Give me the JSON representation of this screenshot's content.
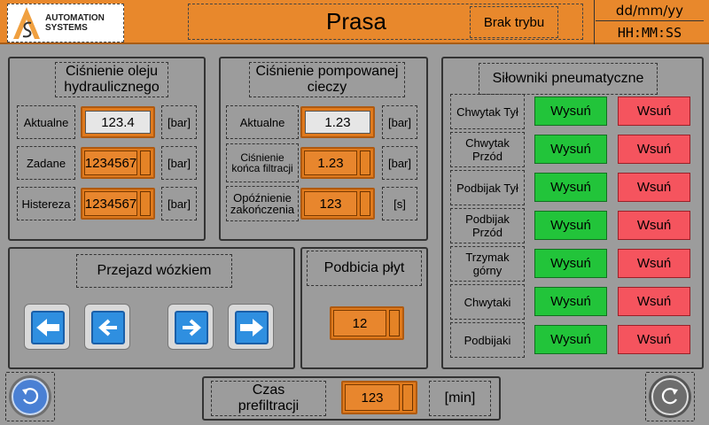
{
  "header": {
    "logo_line1": "AUTOMATION",
    "logo_line2": "SYSTEMS",
    "title": "Prasa",
    "mode": "Brak trybu",
    "date": "dd/mm/yy",
    "time": "HH:MM:SS"
  },
  "oil": {
    "title": "Ciśnienie oleju hydraulicznego",
    "rows": [
      {
        "label": "Aktualne",
        "value": "123.4",
        "unit": "[bar]"
      },
      {
        "label": "Zadane",
        "value": "1234567",
        "unit": "[bar]"
      },
      {
        "label": "Histereza",
        "value": "1234567",
        "unit": "[bar]"
      }
    ]
  },
  "liquid": {
    "title": "Ciśnienie pompowanej cieczy",
    "rows": [
      {
        "label": "Aktualne",
        "value": "1.23",
        "unit": "[bar]"
      },
      {
        "label": "Ciśnienie końca filtracji",
        "value": "1.23",
        "unit": "[bar]"
      },
      {
        "label": "Opóźnienie zakończenia",
        "value": "123",
        "unit": "[s]"
      }
    ]
  },
  "cart": {
    "title": "Przejazd wózkiem"
  },
  "plates": {
    "title": "Podbicia płyt",
    "value": "12"
  },
  "pneumatic": {
    "title": "Siłowniki pneumatyczne",
    "extend_label": "Wysuń",
    "retract_label": "Wsuń",
    "rows": [
      {
        "label": "Chwytak Tył"
      },
      {
        "label": "Chwytak Przód"
      },
      {
        "label": "Podbijak Tył"
      },
      {
        "label": "Podbijak Przód"
      },
      {
        "label": "Trzymak górny"
      },
      {
        "label": "Chwytaki"
      },
      {
        "label": "Podbijaki"
      }
    ]
  },
  "prefiltration": {
    "label": "Czas prefiltracji",
    "value": "123",
    "unit": "[min]"
  },
  "icons": {
    "back": "undo-icon",
    "forward": "redo-icon",
    "arrows": [
      "arrow-left-fast-icon",
      "arrow-left-icon",
      "arrow-right-icon",
      "arrow-right-fast-icon"
    ]
  },
  "colors": {
    "accent": "#e8882c",
    "green": "#22c43a",
    "red": "#f5545e",
    "blue": "#2f8fe0"
  }
}
